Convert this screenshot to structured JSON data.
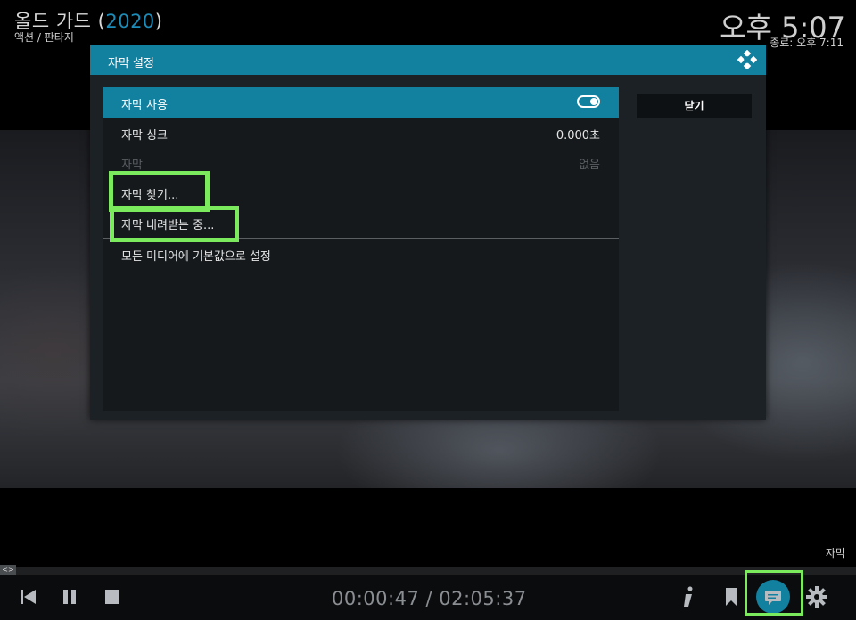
{
  "header": {
    "title": "올드 가드",
    "year": "2020",
    "genre": "액션 / 판타지",
    "clock": "오후 5:07",
    "end_time": "종료: 오후 7:11"
  },
  "dialog": {
    "title": "자막 설정",
    "close_label": "닫기",
    "rows": [
      {
        "label": "자막 사용",
        "value": "",
        "state": "selected",
        "toggle": true
      },
      {
        "label": "자막 싱크",
        "value": "0.000초",
        "state": "normal"
      },
      {
        "label": "자막",
        "value": "없음",
        "state": "disabled"
      },
      {
        "label": "자막 찾기...",
        "value": "",
        "state": "normal"
      },
      {
        "label": "자막 내려받는 중...",
        "value": "",
        "state": "normal"
      },
      {
        "label": "모든 미디어에 기본값으로 설정",
        "value": "",
        "state": "normal"
      }
    ]
  },
  "osd": {
    "current_label": "자막",
    "time": "00:00:47 / 02:05:37",
    "progress_fraction": 0.0063,
    "accent_color": "#12809f",
    "highlight_color": "#7bea5c",
    "controls": [
      "previous-icon",
      "pause-icon",
      "stop-icon",
      "info-icon",
      "bookmark-icon",
      "subtitles-icon",
      "settings-icon"
    ]
  }
}
